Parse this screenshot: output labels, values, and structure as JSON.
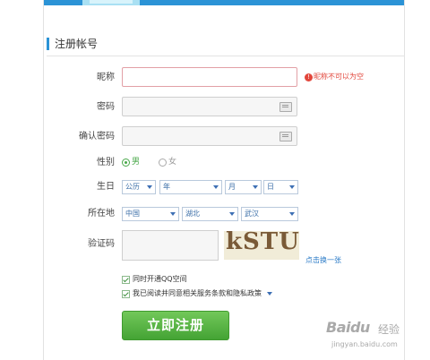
{
  "section_title": "注册帐号",
  "fields": {
    "nickname": {
      "label": "昵称",
      "value": "",
      "error": "昵称不可以为空",
      "error_icon": "!"
    },
    "password": {
      "label": "密码",
      "value": ""
    },
    "confirm_password": {
      "label": "确认密码",
      "value": ""
    },
    "gender": {
      "label": "性别",
      "options": [
        "男",
        "女"
      ],
      "selected": "男"
    },
    "birthday": {
      "label": "生日",
      "calendar": "公历",
      "year": "年",
      "month": "月",
      "day": "日"
    },
    "location": {
      "label": "所在地",
      "country": "中国",
      "province": "湖北",
      "city": "武汉"
    },
    "captcha": {
      "label": "验证码",
      "value": "",
      "image_text": "kSTU",
      "refresh_link": "点击换一张"
    }
  },
  "checkboxes": [
    {
      "label": "同时开通QQ空间",
      "checked": true
    },
    {
      "label": "我已阅读并同意相关服务条款和隐私政策",
      "checked": true
    }
  ],
  "submit_label": "立即注册",
  "watermark": {
    "brand": "Baidu",
    "sub": "经验",
    "domain": "jingyan.baidu.com"
  },
  "colors": {
    "accent": "#2b93d6",
    "button": "#55b342",
    "error": "#e2463b",
    "link": "#2b7bc7"
  }
}
